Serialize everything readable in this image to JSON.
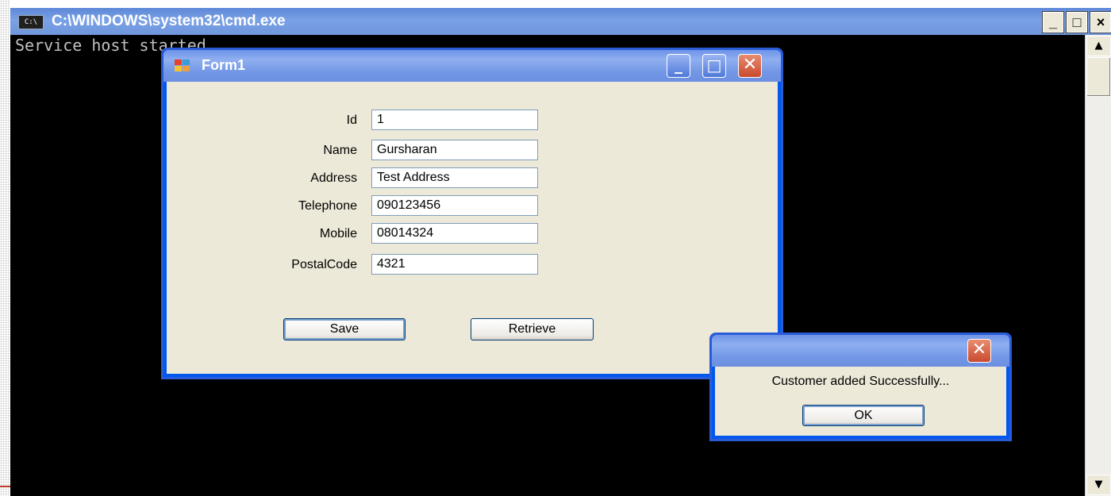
{
  "cmd": {
    "title": "C:\\WINDOWS\\system32\\cmd.exe",
    "icon_label": "C:\\",
    "output_line": "Service host started",
    "buttons": {
      "minimize": "_",
      "maximize": "□",
      "close": "×"
    },
    "scroll_up": "▲",
    "scroll_down": "▼"
  },
  "form": {
    "title": "Form1",
    "title_buttons": {
      "minimize": "_",
      "maximize": "□",
      "close": "✕"
    },
    "fields": [
      {
        "label": "Id",
        "value": "1"
      },
      {
        "label": "Name",
        "value": "Gursharan"
      },
      {
        "label": "Address",
        "value": "Test Address"
      },
      {
        "label": "Telephone",
        "value": "090123456"
      },
      {
        "label": "Mobile",
        "value": "08014324"
      },
      {
        "label": "PostalCode",
        "value": "4321"
      }
    ],
    "save_label": "Save",
    "retrieve_label": "Retrieve"
  },
  "dialog": {
    "close": "✕",
    "message": "Customer added Successfully...",
    "ok_label": "OK"
  },
  "colors": {
    "xp_title": "#7397e6",
    "xp_face": "#ece9d8",
    "console_bg": "#000000",
    "console_text": "#c0c0c0"
  }
}
